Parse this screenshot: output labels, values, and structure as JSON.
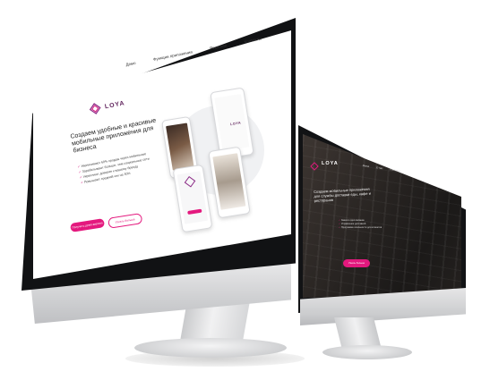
{
  "large_screen": {
    "brand": "LOYA",
    "nav": [
      "Демо",
      "Функции приложения",
      "Решения",
      "Контакты"
    ],
    "hero_title_line1": "Создаем удобные и красивые",
    "hero_title_line2": "мобильные приложения для бизнеса",
    "features": [
      "Увеличивают 60% продаж через мобильные",
      "Зарабатывают больше, чем социальные сети",
      "Укрепляют доверие к вашему бренду",
      "Повышают средний чек на 30%"
    ],
    "primary_button": "Получить демо-версию",
    "secondary_button": "Узнать больше",
    "phone_brand": "LOYA"
  },
  "small_screen": {
    "brand": "LOYA",
    "nav": [
      "Меню",
      "О нас",
      "Контакты"
    ],
    "hero_title": "Создаем мобильные приложения для службы доставки еды, кафе и ресторанов",
    "features": [
      "Заказ в одно касание",
      "Управление доставкой",
      "Программа лояльности для клиентов"
    ],
    "button": "Узнать больше"
  },
  "colors": {
    "accent": "#e4197e",
    "brand_dark": "#5c1e58"
  }
}
